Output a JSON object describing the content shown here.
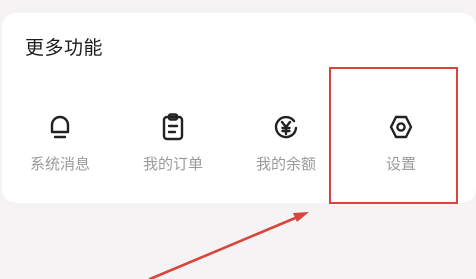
{
  "section": {
    "title": "更多功能"
  },
  "features": [
    {
      "label": "系统消息",
      "icon": "bell-icon"
    },
    {
      "label": "我的订单",
      "icon": "clipboard-icon"
    },
    {
      "label": "我的余额",
      "icon": "yen-coin-icon"
    },
    {
      "label": "设置",
      "icon": "settings-hexagon-icon"
    }
  ],
  "annotation": {
    "highlight_color": "#d9453c"
  },
  "colors": {
    "icon_stroke": "#222222",
    "label": "#9a9a9a",
    "title": "#1c1c1c"
  }
}
